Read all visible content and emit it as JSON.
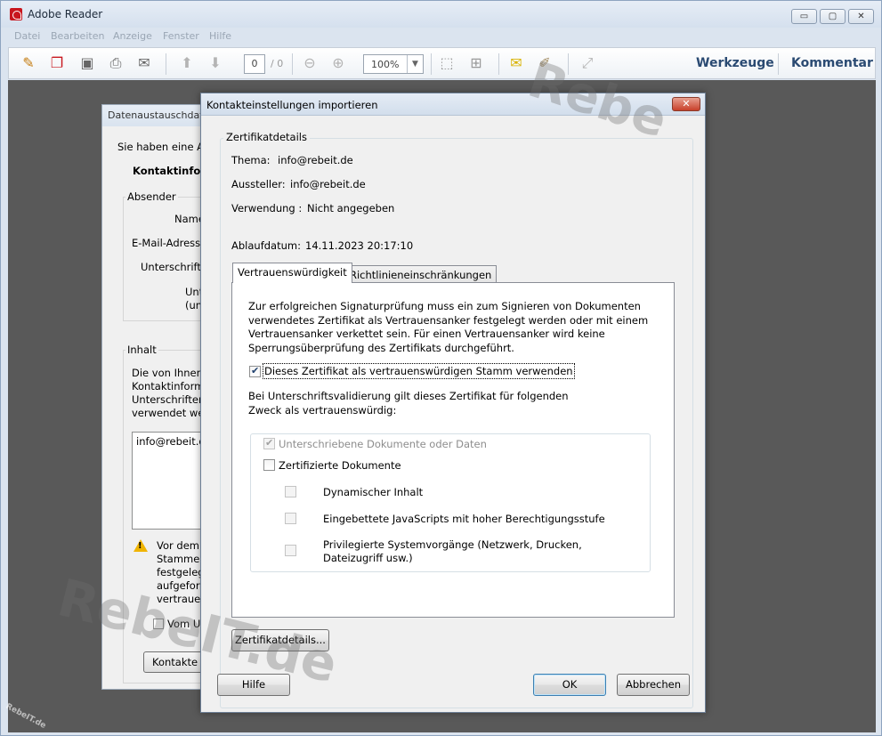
{
  "app": {
    "title": "Adobe Reader",
    "window_buttons": [
      "▭",
      "▢",
      "✕"
    ]
  },
  "menu": [
    "Datei",
    "Bearbeiten",
    "Anzeige",
    "Fenster",
    "Hilfe"
  ],
  "toolbar": {
    "page_current": "0",
    "page_total": "/ 0",
    "zoom": "100%",
    "tools_label": "Werkzeuge",
    "comment_label": "Kommentar"
  },
  "background_dialog": {
    "title": "Datenaustauschdatei",
    "intro": "Sie haben eine Ac",
    "contact_heading": "Kontaktinform",
    "sender_label": "Absender",
    "name_label": "Name",
    "email_label": "E-Mail-Adresse",
    "signature_label": "Unterschrift",
    "signature_sub1": "Unt",
    "signature_sub2": "(un",
    "content_label": "Inhalt",
    "content_lines": [
      "Die von Ihnen",
      "Kontaktinform",
      "Unterschriften",
      "verwendet wer"
    ],
    "list_item": "info@rebeit.d",
    "warning_lines": [
      "Vor dem",
      "Stammer",
      "festgeleg",
      "aufgeforc",
      "vertrauer"
    ],
    "checkbox_label": "Vom U",
    "contacts_button": "Kontakte z"
  },
  "dialog": {
    "title": "Kontakteinstellungen importieren",
    "close": "✕",
    "group_label": "Zertifikatdetails",
    "subject_label": "Thema:",
    "subject_value": "info@rebeit.de",
    "issuer_label": "Aussteller:",
    "issuer_value": "info@rebeit.de",
    "usage_label": "Verwendung :",
    "usage_value": "Nicht angegeben",
    "expiry_label": "Ablaufdatum:",
    "expiry_value": "14.11.2023 20:17:10",
    "tabs": [
      "Vertrauenswürdigkeit",
      "Richtlinieneinschränkungen"
    ],
    "trust_description": [
      "Zur erfolgreichen Signaturprüfung muss ein zum Signieren von Dokumenten",
      "verwendetes Zertifikat als Vertrauensanker festgelegt werden oder mit einem",
      "Vertrauensanker verkettet sein. Für einen Vertrauensanker wird keine",
      "Sperrungsüberprüfung des Zertifikats durchgeführt."
    ],
    "root_checkbox": "Dieses Zertifikat als vertrauenswürdigen Stamm verwenden",
    "purpose_text": [
      "Bei Unterschriftsvalidierung gilt dieses Zertifikat für folgenden",
      "Zweck als vertrauenswürdig:"
    ],
    "signed_docs": "Unterschriebene Dokumente oder Daten",
    "certified_docs": "Zertifizierte Dokumente",
    "dynamic_content": "Dynamischer Inhalt",
    "embedded_js": "Eingebettete JavaScripts mit hoher Berechtigungsstufe",
    "privileged_ops": [
      "Privilegierte Systemvorgänge (Netzwerk, Drucken,",
      "Dateizugriff usw.)"
    ],
    "cert_details_button": "Zertifikatdetails...",
    "help_button": "Hilfe",
    "ok_button": "OK",
    "cancel_button": "Abbrechen"
  },
  "watermarks": [
    "Rebe",
    "RebeIT.de",
    "RebeIT.de"
  ]
}
